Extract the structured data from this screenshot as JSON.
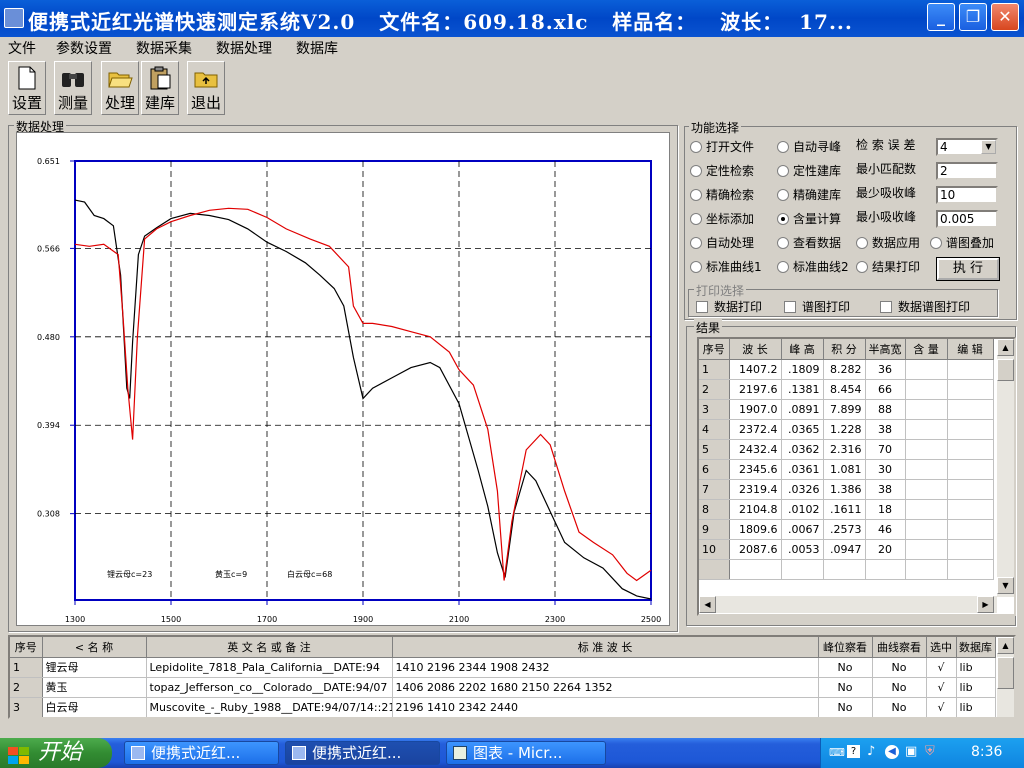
{
  "window": {
    "title": "便携式近红光谱快速测定系统V2.0   文件名：609.18.xlc   样品名：   波长：  17..."
  },
  "menu": [
    "文件",
    "参数设置",
    "数据采集",
    "数据处理",
    "数据库"
  ],
  "toolbar": [
    {
      "label": "设置",
      "icon": "new-file-icon"
    },
    {
      "label": "测量",
      "icon": "binoculars-icon"
    },
    {
      "label": "处理",
      "icon": "open-folder-icon"
    },
    {
      "label": "建库",
      "icon": "clipboard-icon"
    },
    {
      "label": "退出",
      "icon": "exit-icon"
    }
  ],
  "plot_panel": {
    "label": "数据处理"
  },
  "chart_data": {
    "type": "line",
    "y_ticks": [
      "0.651",
      "0.566",
      "0.480",
      "0.394",
      "0.308"
    ],
    "x_ticks": [
      "1300",
      "1500",
      "1700",
      "1900",
      "2100",
      "2300",
      "2500"
    ],
    "ylim": [
      0.224,
      0.651
    ],
    "xlim": [
      1300,
      2500
    ],
    "grid": "dashed",
    "annotations": [
      "锂云母c=23",
      "黄玉c=9",
      "白云母c=68"
    ],
    "series": [
      {
        "color": "#000000",
        "points": [
          [
            1300,
            0.613
          ],
          [
            1320,
            0.611
          ],
          [
            1340,
            0.598
          ],
          [
            1360,
            0.595
          ],
          [
            1380,
            0.588
          ],
          [
            1395,
            0.54
          ],
          [
            1408,
            0.43
          ],
          [
            1414,
            0.42
          ],
          [
            1420,
            0.475
          ],
          [
            1432,
            0.56
          ],
          [
            1445,
            0.578
          ],
          [
            1470,
            0.586
          ],
          [
            1500,
            0.595
          ],
          [
            1540,
            0.6
          ],
          [
            1580,
            0.598
          ],
          [
            1620,
            0.594
          ],
          [
            1660,
            0.585
          ],
          [
            1700,
            0.572
          ],
          [
            1740,
            0.563
          ],
          [
            1780,
            0.552
          ],
          [
            1810,
            0.54
          ],
          [
            1840,
            0.527
          ],
          [
            1860,
            0.51
          ],
          [
            1880,
            0.46
          ],
          [
            1900,
            0.42
          ],
          [
            1920,
            0.43
          ],
          [
            1960,
            0.44
          ],
          [
            2000,
            0.45
          ],
          [
            2040,
            0.455
          ],
          [
            2060,
            0.45
          ],
          [
            2100,
            0.415
          ],
          [
            2140,
            0.35
          ],
          [
            2160,
            0.315
          ],
          [
            2180,
            0.27
          ],
          [
            2196,
            0.246
          ],
          [
            2215,
            0.31
          ],
          [
            2240,
            0.35
          ],
          [
            2260,
            0.34
          ],
          [
            2290,
            0.31
          ],
          [
            2320,
            0.28
          ],
          [
            2360,
            0.265
          ],
          [
            2400,
            0.255
          ],
          [
            2440,
            0.235
          ],
          [
            2470,
            0.228
          ],
          [
            2500,
            0.225
          ]
        ]
      },
      {
        "color": "#e00000",
        "points": [
          [
            1300,
            0.57
          ],
          [
            1330,
            0.568
          ],
          [
            1360,
            0.57
          ],
          [
            1390,
            0.56
          ],
          [
            1400,
            0.5
          ],
          [
            1410,
            0.43
          ],
          [
            1420,
            0.38
          ],
          [
            1430,
            0.48
          ],
          [
            1445,
            0.575
          ],
          [
            1470,
            0.585
          ],
          [
            1500,
            0.592
          ],
          [
            1540,
            0.598
          ],
          [
            1580,
            0.603
          ],
          [
            1620,
            0.605
          ],
          [
            1660,
            0.604
          ],
          [
            1700,
            0.596
          ],
          [
            1740,
            0.585
          ],
          [
            1790,
            0.575
          ],
          [
            1830,
            0.568
          ],
          [
            1870,
            0.548
          ],
          [
            1880,
            0.51
          ],
          [
            1900,
            0.493
          ],
          [
            1920,
            0.493
          ],
          [
            1960,
            0.49
          ],
          [
            2000,
            0.485
          ],
          [
            2040,
            0.48
          ],
          [
            2080,
            0.465
          ],
          [
            2100,
            0.448
          ],
          [
            2130,
            0.433
          ],
          [
            2160,
            0.39
          ],
          [
            2180,
            0.33
          ],
          [
            2194,
            0.243
          ],
          [
            2210,
            0.3
          ],
          [
            2240,
            0.37
          ],
          [
            2270,
            0.385
          ],
          [
            2290,
            0.375
          ],
          [
            2320,
            0.33
          ],
          [
            2350,
            0.29
          ],
          [
            2380,
            0.28
          ],
          [
            2420,
            0.268
          ],
          [
            2450,
            0.25
          ],
          [
            2470,
            0.243
          ],
          [
            2500,
            0.253
          ]
        ]
      }
    ]
  },
  "function_panel": {
    "label": "功能选择",
    "radios": [
      {
        "label": "打开文件",
        "on": false
      },
      {
        "label": "自动寻峰",
        "on": false
      },
      {
        "label": "定性检索",
        "on": false
      },
      {
        "label": "定性建库",
        "on": false
      },
      {
        "label": "精确检索",
        "on": false
      },
      {
        "label": "精确建库",
        "on": false
      },
      {
        "label": "坐标添加",
        "on": false
      },
      {
        "label": "含量计算",
        "on": true
      },
      {
        "label": "自动处理",
        "on": false
      },
      {
        "label": "查看数据",
        "on": false
      },
      {
        "label": "数据应用",
        "on": false
      },
      {
        "label": "谱图叠加",
        "on": false
      },
      {
        "label": "标准曲线1",
        "on": false
      },
      {
        "label": "标准曲线2",
        "on": false
      },
      {
        "label": "结果打印",
        "on": false
      }
    ],
    "params": [
      {
        "label": "检 索 误 差",
        "value": "4"
      },
      {
        "label": "最小匹配数",
        "value": "2"
      },
      {
        "label": "最少吸收峰",
        "value": "10"
      },
      {
        "label": "最小吸收峰",
        "value": "0.005"
      }
    ],
    "execute": "执  行",
    "print_label": "打印选择",
    "prints": [
      "数据打印",
      "谱图打印",
      "数据谱图打印"
    ]
  },
  "results": {
    "label": "结果",
    "headers": [
      "序号",
      "波    长",
      "峰  高",
      "积  分",
      "半高宽",
      "含  量",
      "编  辑"
    ],
    "rows": [
      [
        "1",
        "1407.2",
        ".1809",
        "8.282",
        "36",
        "",
        ""
      ],
      [
        "2",
        "2197.6",
        ".1381",
        "8.454",
        "66",
        "",
        ""
      ],
      [
        "3",
        "1907.0",
        ".0891",
        "7.899",
        "88",
        "",
        ""
      ],
      [
        "4",
        "2372.4",
        ".0365",
        "1.228",
        "38",
        "",
        ""
      ],
      [
        "5",
        "2432.4",
        ".0362",
        "2.316",
        "70",
        "",
        ""
      ],
      [
        "6",
        "2345.6",
        ".0361",
        "1.081",
        "30",
        "",
        ""
      ],
      [
        "7",
        "2319.4",
        ".0326",
        "1.386",
        "38",
        "",
        ""
      ],
      [
        "8",
        "2104.8",
        ".0102",
        ".1611",
        "18",
        "",
        ""
      ],
      [
        "9",
        "1809.6",
        ".0067",
        ".2573",
        "46",
        "",
        ""
      ],
      [
        "10",
        "2087.6",
        ".0053",
        ".0947",
        "20",
        "",
        ""
      ]
    ]
  },
  "library": {
    "headers": [
      "序号",
      "< 名      称",
      "英  文    名    或  备    注",
      "标          准          波          长",
      "峰位察看",
      "曲线察看",
      "选中",
      "数据库"
    ],
    "rows": [
      [
        "1",
        "锂云母",
        "Lepidolite_7818_Pala_California__DATE:94",
        "1410   2196   2344   1908   2432",
        "No",
        "No",
        "√",
        "lib"
      ],
      [
        "2",
        "黄玉",
        "topaz_Jefferson_co__Colorado__DATE:94/07",
        "1406   2086   2202   1680   2150   2264   1352",
        "No",
        "No",
        "√",
        "lib"
      ],
      [
        "3",
        "白云母",
        "Muscovite_-_Ruby_1988__DATE:94/07/14::21",
        "2196   1410   2342   2440",
        "No",
        "No",
        "√",
        "lib"
      ]
    ]
  },
  "taskbar": {
    "start": "开始",
    "tasks": [
      "便携式近红...",
      "便携式近红...",
      "图表 - Micr..."
    ],
    "clock": "8:36"
  }
}
